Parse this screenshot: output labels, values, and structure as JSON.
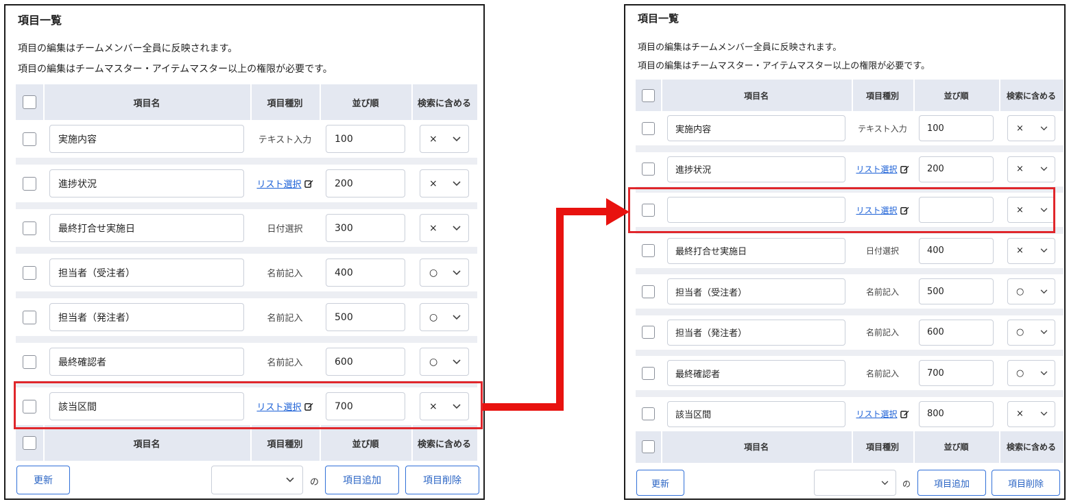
{
  "panels": {
    "left": {
      "title": "項目一覧",
      "note1": "項目の編集はチームメンバー全員に反映されます。",
      "note2": "項目の編集はチームマスター・アイテムマスター以上の権限が必要です。",
      "header": {
        "name": "項目名",
        "type": "項目種別",
        "order": "並び順",
        "search": "検索に含める"
      },
      "rows": [
        {
          "name": "実施内容",
          "type": "テキスト入力",
          "type_link": false,
          "order": "100",
          "search": "×"
        },
        {
          "name": "進捗状況",
          "type": "リスト選択",
          "type_link": true,
          "order": "200",
          "search": "×"
        },
        {
          "name": "最終打合せ実施日",
          "type": "日付選択",
          "type_link": false,
          "order": "300",
          "search": "×"
        },
        {
          "name": "担当者（受注者）",
          "type": "名前記入",
          "type_link": false,
          "order": "400",
          "search": "○"
        },
        {
          "name": "担当者（発注者）",
          "type": "名前記入",
          "type_link": false,
          "order": "500",
          "search": "○"
        },
        {
          "name": "最終確認者",
          "type": "名前記入",
          "type_link": false,
          "order": "600",
          "search": "○"
        },
        {
          "name": "該当区間",
          "type": "リスト選択",
          "type_link": true,
          "order": "700",
          "search": "×"
        }
      ],
      "footer": {
        "update": "更新",
        "no": "の",
        "add": "項目追加",
        "delete": "項目削除"
      }
    },
    "right": {
      "title": "項目一覧",
      "note1": "項目の編集はチームメンバー全員に反映されます。",
      "note2": "項目の編集はチームマスター・アイテムマスター以上の権限が必要です。",
      "header": {
        "name": "項目名",
        "type": "項目種別",
        "order": "並び順",
        "search": "検索に含める"
      },
      "rows": [
        {
          "name": "実施内容",
          "type": "テキスト入力",
          "type_link": false,
          "order": "100",
          "search": "×"
        },
        {
          "name": "進捗状況",
          "type": "リスト選択",
          "type_link": true,
          "order": "200",
          "search": "×"
        },
        {
          "name": "",
          "type": "リスト選択",
          "type_link": true,
          "order": "",
          "search": "×"
        },
        {
          "name": "最終打合せ実施日",
          "type": "日付選択",
          "type_link": false,
          "order": "400",
          "search": "×"
        },
        {
          "name": "担当者（受注者）",
          "type": "名前記入",
          "type_link": false,
          "order": "500",
          "search": "○"
        },
        {
          "name": "担当者（発注者）",
          "type": "名前記入",
          "type_link": false,
          "order": "600",
          "search": "○"
        },
        {
          "name": "最終確認者",
          "type": "名前記入",
          "type_link": false,
          "order": "700",
          "search": "○"
        },
        {
          "name": "該当区間",
          "type": "リスト選択",
          "type_link": true,
          "order": "800",
          "search": "×"
        }
      ],
      "footer": {
        "update": "更新",
        "no": "の",
        "add": "項目追加",
        "delete": "項目削除"
      }
    }
  },
  "colors": {
    "header_bg": "#e4e8f1",
    "band_bg": "#eceef3",
    "link": "#1a5fd6",
    "button": "#2f6fd8",
    "highlight": "#e0262b",
    "arrow": "#e8120f"
  }
}
